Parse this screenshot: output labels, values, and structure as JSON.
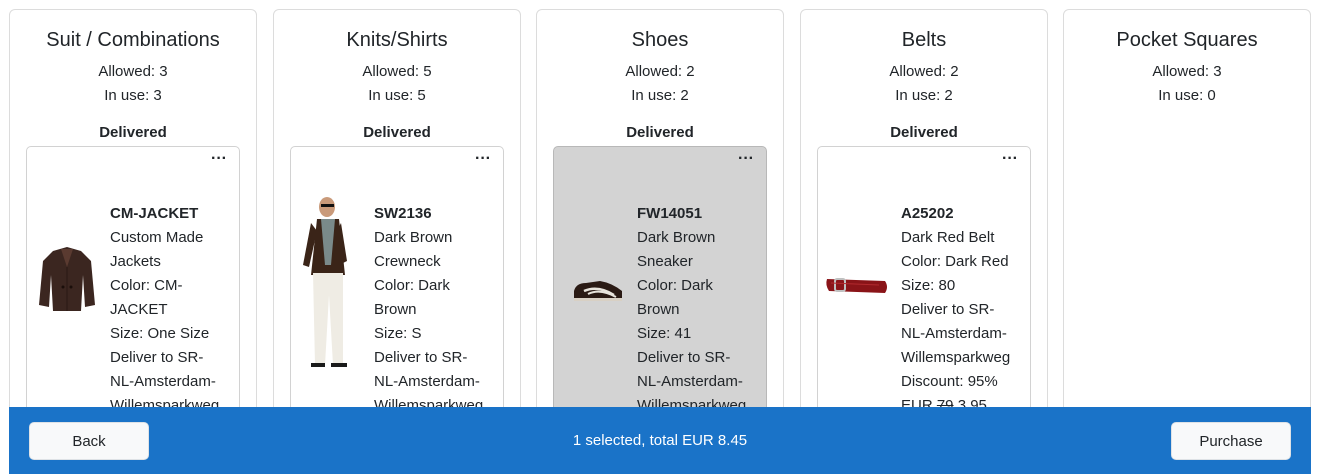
{
  "columns": [
    {
      "title": "Suit / Combinations",
      "allowed": "Allowed: 3",
      "in_use": "In use: 3",
      "status": "Delivered",
      "card": {
        "sku": "CM-JACKET",
        "lines": [
          "Custom Made",
          "Jackets",
          "Color: CM-",
          "JACKET",
          "Size: One Size",
          "Deliver to SR-",
          "NL-Amsterdam-",
          "Willemsparkweg"
        ],
        "image": "jacket-image",
        "selected": false
      }
    },
    {
      "title": "Knits/Shirts",
      "allowed": "Allowed: 5",
      "in_use": "In use: 5",
      "status": "Delivered",
      "card": {
        "sku": "SW2136",
        "lines": [
          "Dark Brown",
          "Crewneck",
          "Color: Dark",
          "Brown",
          "Size: S",
          "Deliver to SR-",
          "NL-Amsterdam-",
          "Willemsparkweg"
        ],
        "image": "model-image",
        "selected": false
      }
    },
    {
      "title": "Shoes",
      "allowed": "Allowed: 2",
      "in_use": "In use: 2",
      "status": "Delivered",
      "card": {
        "sku": "FW14051",
        "lines": [
          "Dark Brown",
          "Sneaker",
          "Color: Dark",
          "Brown",
          "Size: 41",
          "Deliver to SR-",
          "NL-Amsterdam-",
          "Willemsparkweg"
        ],
        "image": "sneaker-image",
        "selected": true
      }
    },
    {
      "title": "Belts",
      "allowed": "Allowed: 2",
      "in_use": "In use: 2",
      "status": "Delivered",
      "card": {
        "sku": "A25202",
        "lines": [
          "Dark Red Belt",
          "Color: Dark Red",
          "Size: 80",
          "Deliver to SR-",
          "NL-Amsterdam-",
          "Willemsparkweg",
          "Discount: 95%"
        ],
        "price_prefix": "EUR ",
        "price_old": "79",
        "price_new": " 3.95",
        "image": "belt-image",
        "selected": false
      }
    },
    {
      "title": "Pocket Squares",
      "allowed": "Allowed: 3",
      "in_use": "In use: 0"
    }
  ],
  "card_menu_label": "···",
  "footer": {
    "back_label": "Back",
    "status": "1 selected, total EUR 8.45",
    "purchase_label": "Purchase"
  },
  "colors": {
    "footer_bg": "#1a73c8",
    "selected_card_bg": "#d3d3d3"
  }
}
